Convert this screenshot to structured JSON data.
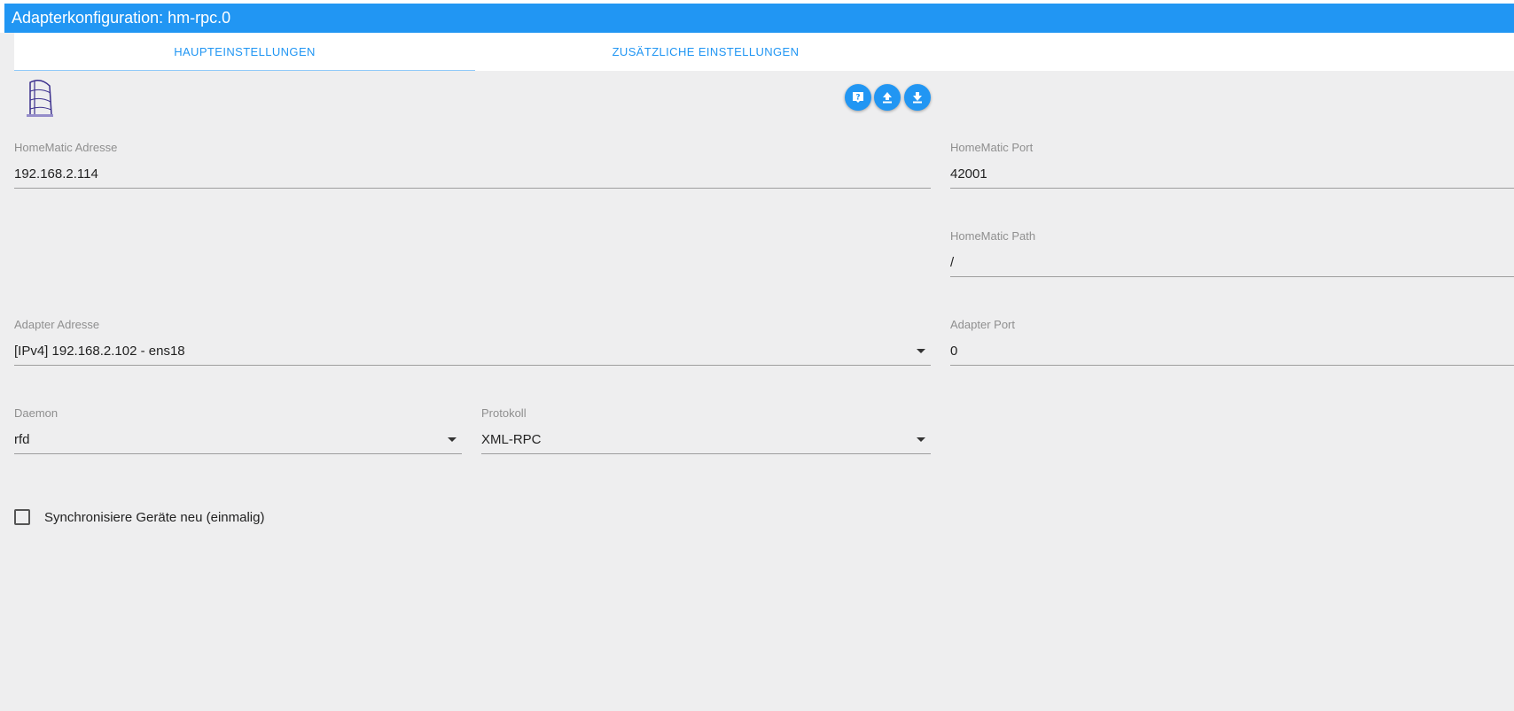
{
  "window": {
    "title": "Adapterkonfiguration: hm-rpc.0"
  },
  "tabs": [
    {
      "label": "HAUPTEINSTELLUNGEN",
      "active": true
    },
    {
      "label": "ZUSÄTZLICHE EINSTELLUNGEN",
      "active": false
    }
  ],
  "toolbar": {
    "icons": [
      "help-icon",
      "upload-icon",
      "download-icon"
    ]
  },
  "fields": {
    "homematic_address": {
      "label": "HomeMatic Adresse",
      "value": "192.168.2.114"
    },
    "homematic_port": {
      "label": "HomeMatic Port",
      "value": "42001"
    },
    "homematic_path": {
      "label": "HomeMatic Path",
      "value": "/"
    },
    "adapter_address": {
      "label": "Adapter Adresse",
      "value": "[IPv4] 192.168.2.102 - ens18"
    },
    "adapter_port": {
      "label": "Adapter Port",
      "value": "0"
    },
    "daemon": {
      "label": "Daemon",
      "value": "rfd"
    },
    "protocol": {
      "label": "Protokoll",
      "value": "XML-RPC"
    }
  },
  "sync_devices": {
    "label": "Synchronisiere Geräte neu (einmalig)",
    "checked": false
  },
  "colors": {
    "accent": "#2196f3",
    "background": "#eeeeef"
  }
}
